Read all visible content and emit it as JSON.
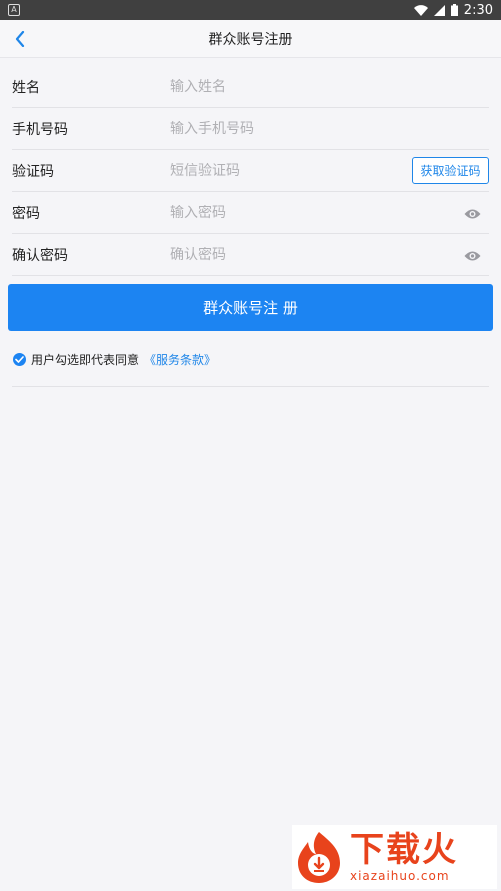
{
  "statusbar": {
    "time": "2:30"
  },
  "header": {
    "title": "群众账号注册"
  },
  "form": {
    "name": {
      "label": "姓名",
      "placeholder": "输入姓名"
    },
    "phone": {
      "label": "手机号码",
      "placeholder": "输入手机号码"
    },
    "code": {
      "label": "验证码",
      "placeholder": "短信验证码",
      "button": "获取验证码"
    },
    "password": {
      "label": "密码",
      "placeholder": "输入密码"
    },
    "confirm": {
      "label": "确认密码",
      "placeholder": "确认密码"
    }
  },
  "submit_label": "群众账号注 册",
  "agreement": {
    "text": "用户勾选即代表同意",
    "link": "《服务条款》"
  },
  "watermark": {
    "title": "下载火",
    "url": "xiazaihuo.com"
  },
  "colors": {
    "accent": "#1c84f2",
    "watermark": "#e8431c"
  }
}
